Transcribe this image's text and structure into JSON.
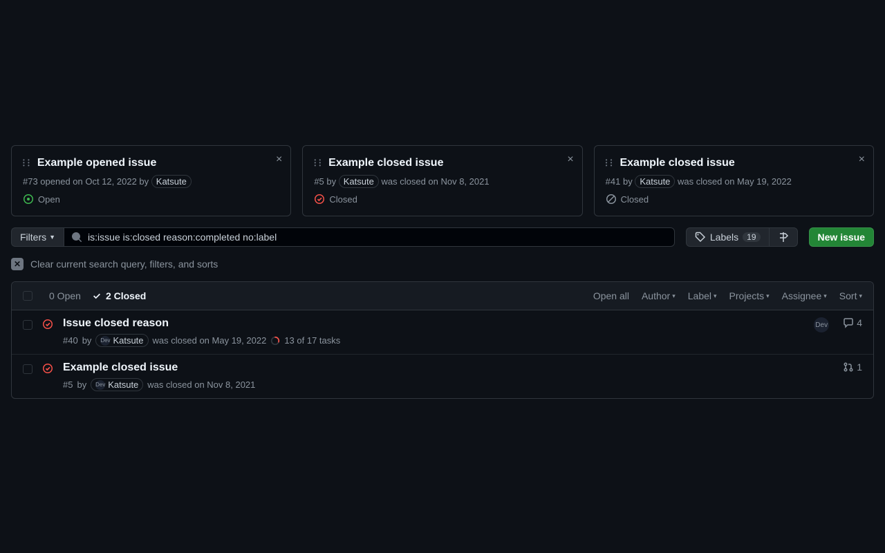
{
  "pinned": [
    {
      "title": "Example opened issue",
      "meta_before": "#73 opened on Oct 12, 2022 by",
      "author": "Katsute",
      "meta_after": "",
      "status": "Open",
      "status_kind": "open"
    },
    {
      "title": "Example closed issue",
      "meta_before": "#5 by",
      "author": "Katsute",
      "meta_after": "was closed on Nov 8, 2021",
      "status": "Closed",
      "status_kind": "closed-done"
    },
    {
      "title": "Example closed issue",
      "meta_before": "#41 by",
      "author": "Katsute",
      "meta_after": "was closed on May 19, 2022",
      "status": "Closed",
      "status_kind": "closed-not"
    }
  ],
  "filters_label": "Filters",
  "search_value": "is:issue is:closed reason:completed no:label",
  "labels_label": "Labels",
  "labels_count": "19",
  "new_issue_label": "New issue",
  "clear_label": "Clear current search query, filters, and sorts",
  "header": {
    "open_count": "0 Open",
    "closed_count": "2 Closed",
    "open_all": "Open all",
    "author": "Author",
    "label": "Label",
    "projects": "Projects",
    "assignee": "Assignee",
    "sort": "Sort"
  },
  "rows": [
    {
      "title": "Issue closed reason",
      "num": "#40",
      "by": "by",
      "author": "Katsute",
      "after": "was closed on May 19, 2022",
      "tasks": "13 of 17 tasks",
      "dev_badge": "Dev",
      "comments": "4",
      "has_tasks": true,
      "has_dev": true,
      "has_comments": true,
      "has_pr": false,
      "pr": ""
    },
    {
      "title": "Example closed issue",
      "num": "#5",
      "by": "by",
      "author": "Katsute",
      "after": "was closed on Nov 8, 2021",
      "tasks": "",
      "dev_badge": "",
      "comments": "",
      "has_tasks": false,
      "has_dev": false,
      "has_comments": false,
      "has_pr": true,
      "pr": "1"
    }
  ]
}
